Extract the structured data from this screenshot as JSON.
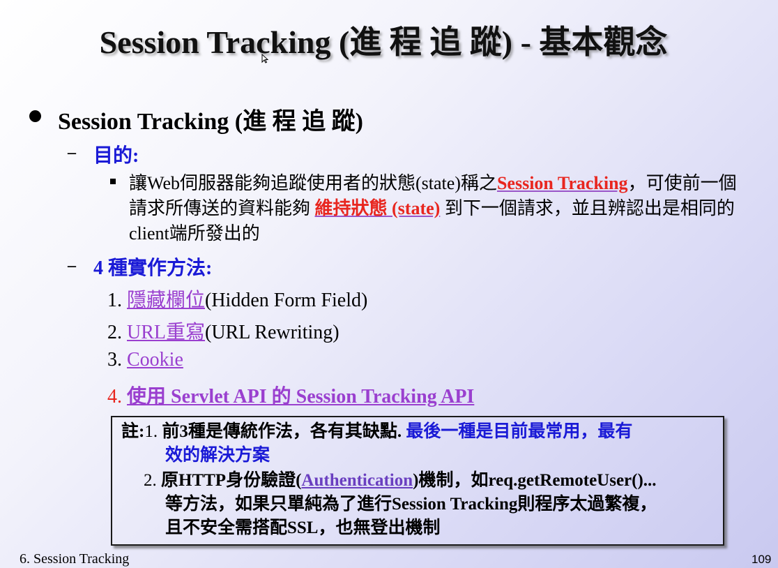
{
  "slide": {
    "title": "Session Tracking (進 程 追 蹤) - 基本觀念",
    "bullet": "Session Tracking (進 程 追 蹤)",
    "purpose_dash": "–",
    "purpose_heading": "目的:",
    "purpose_text_1": "讓Web伺服器能夠追蹤使用者的狀態(state)稱之",
    "purpose_highlight_1": "Session Tracking",
    "purpose_text_2": "，可使前一個請求所傳送的資料能夠",
    "purpose_highlight_2": "維持狀態 (state)",
    "purpose_text_3": "到下一個請求，並且辨認出是相同的client端所發出的",
    "methods_dash": "–",
    "methods_heading": "4 種實作方法:",
    "methods": [
      {
        "num": "1.",
        "link": "隱藏欄位",
        "rest": "(Hidden Form Field)"
      },
      {
        "num": "2.",
        "link": "URL重寫",
        "rest": "(URL Rewriting)"
      },
      {
        "num": "3.",
        "link": "Cookie",
        "rest": ""
      },
      {
        "num": "4.",
        "link": "使用 Servlet API 的 Session Tracking API",
        "rest": ""
      }
    ],
    "note": {
      "label": "註:",
      "n1_num": "1.",
      "n1_black": "前3種是傳統作法，各有其缺點.",
      "n1_blue_a": "最後一種是目前最常用，最有",
      "n1_blue_b": "效的解決方案",
      "n2_num": "2.",
      "n2_a": "原HTTP身份驗證(",
      "n2_link": "Authentication",
      "n2_b": ")機制，如req.getRemoteUser()...",
      "n2_c": "等方法，如果只單純為了進行Session Tracking則程序太過繁複，",
      "n2_d": "且不安全需搭配SSL，也無登出機制"
    }
  },
  "footer": {
    "section": "6. Session Tracking",
    "page": "109"
  },
  "colors": {
    "heading_blue": "#1a1ad6",
    "highlight_red": "#e8261f",
    "link_purple": "#9a3fcf"
  }
}
